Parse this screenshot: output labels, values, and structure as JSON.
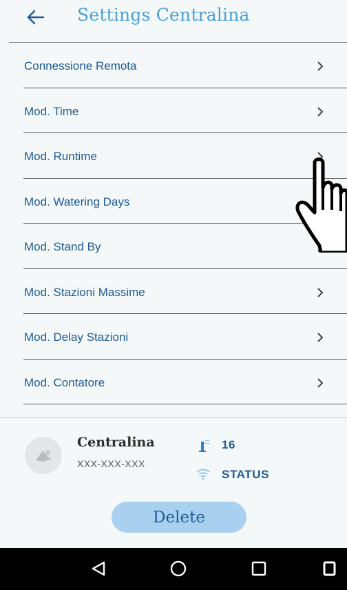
{
  "header": {
    "title": "Settings Centralina",
    "back_icon": "arrow-left-icon",
    "accent_color": "#4aa0d6"
  },
  "menu": {
    "items": [
      {
        "label": "Connessione Remota"
      },
      {
        "label": "Mod. Time"
      },
      {
        "label": "Mod. Runtime"
      },
      {
        "label": "Mod. Watering Days"
      },
      {
        "label": "Mod. Stand By"
      },
      {
        "label": "Mod. Stazioni Massime"
      },
      {
        "label": "Mod. Delay Stazioni"
      },
      {
        "label": "Mod. Contatore"
      }
    ],
    "chevron_icon": "chevron-right-icon",
    "label_color": "#1e5a93"
  },
  "device": {
    "name": "Centralina",
    "id": "XXX-XXX-XXX",
    "stations_count": "16",
    "status_label": "STATUS",
    "avatar_icon": "device-placeholder-icon",
    "stations_icon": "sprinkler-icon",
    "status_icon": "wifi-icon"
  },
  "actions": {
    "delete_label": "Delete",
    "delete_color": "#a9d1ef"
  },
  "overlay": {
    "pointer_icon": "hand-pointer-icon"
  },
  "system_nav": {
    "back_icon": "triangle-back-icon",
    "home_icon": "circle-home-icon",
    "recents_icon": "square-recents-icon",
    "extra_icon": "square-icon"
  }
}
